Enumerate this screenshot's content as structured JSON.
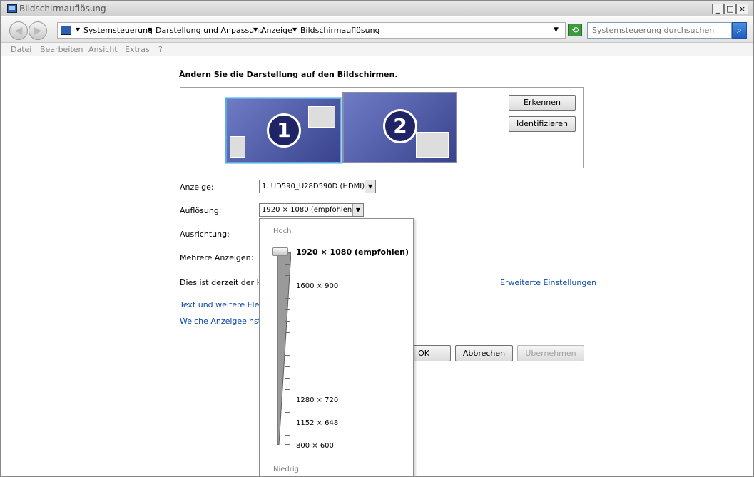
{
  "window": {
    "title": "Bildschirmauflösung"
  },
  "nav": {
    "breadcrumbs": [
      "Systemsteuerung",
      "Darstellung und Anpassung",
      "Anzeige",
      "Bildschirmauflösung"
    ],
    "search_placeholder": "Systemsteuerung durchsuchen"
  },
  "menu": [
    "Datei",
    "Bearbeiten",
    "Ansicht",
    "Extras",
    "?"
  ],
  "main": {
    "heading": "Ändern Sie die Darstellung auf den Bildschirmen.",
    "monitors": [
      {
        "number": "1",
        "selected": true
      },
      {
        "number": "2",
        "selected": false
      }
    ],
    "detect_button": "Erkennen",
    "identify_button": "Identifizieren",
    "labels": {
      "display": "Anzeige:",
      "resolution": "Auflösung:",
      "orientation": "Ausrichtung:",
      "multiple": "Mehrere Anzeigen:"
    },
    "display_value": "1. UD590_U28D590D (HDMI)",
    "resolution_value": "1920 × 1080 (empfohlen)",
    "main_display_text": "Dies ist derzeit der Hau",
    "advanced_link": "Erweiterte Einstellungen",
    "link_text_size": "Text und weitere Eleme",
    "link_which_settings": "Welche Anzeigeeinstellu",
    "buttons": {
      "ok": "OK",
      "cancel": "Abbrechen",
      "apply": "Übernehmen"
    }
  },
  "resolution_dropdown": {
    "high_label": "Hoch",
    "low_label": "Niedrig",
    "options": [
      {
        "label": "1920 × 1080 (empfohlen)",
        "selected": true
      },
      {
        "label": "1600 × 900",
        "selected": false
      },
      {
        "label": "1280 × 720",
        "selected": false
      },
      {
        "label": "1152 × 648",
        "selected": false
      },
      {
        "label": "800 × 600",
        "selected": false
      }
    ],
    "slider_level": 1.0
  },
  "colors": {
    "link": "#0b4aa8",
    "selection": "#5fa8e0",
    "monitor": "#39438f"
  }
}
